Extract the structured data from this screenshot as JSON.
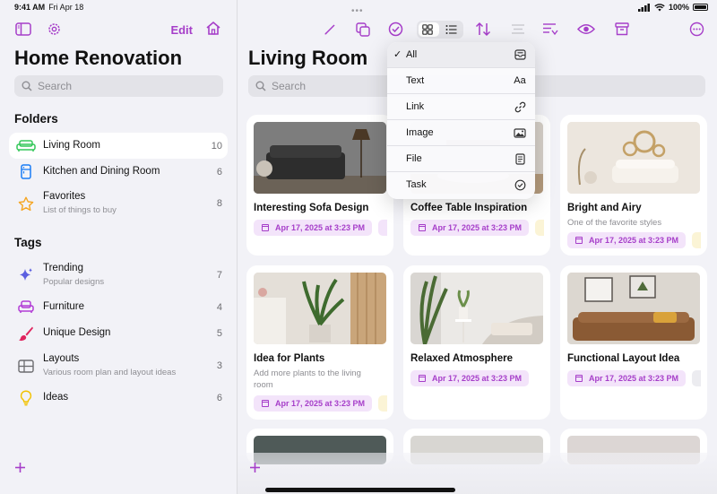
{
  "status": {
    "time": "9:41 AM",
    "date": "Fri Apr 18",
    "battery": "100%"
  },
  "sidebar": {
    "edit_label": "Edit",
    "title": "Home Renovation",
    "search_placeholder": "Search",
    "folders_heading": "Folders",
    "folders": [
      {
        "label": "Living Room",
        "count": "10",
        "icon": "sofa-icon",
        "active": true
      },
      {
        "label": "Kitchen and Dining Room",
        "count": "6",
        "icon": "fridge-icon"
      },
      {
        "label": "Favorites",
        "sub": "List of things to buy",
        "count": "8",
        "icon": "star-icon"
      }
    ],
    "tags_heading": "Tags",
    "tags": [
      {
        "label": "Trending",
        "sub": "Popular designs",
        "count": "7",
        "icon": "sparkles-icon"
      },
      {
        "label": "Furniture",
        "count": "4",
        "icon": "armchair-icon"
      },
      {
        "label": "Unique Design",
        "count": "5",
        "icon": "paintbrush-icon"
      },
      {
        "label": "Layouts",
        "sub": "Various room plan and layout ideas",
        "count": "3",
        "icon": "grid-layout-icon"
      },
      {
        "label": "Ideas",
        "count": "6",
        "icon": "lightbulb-icon"
      }
    ]
  },
  "main": {
    "title": "Living Room",
    "search_placeholder": "Search",
    "cards": [
      {
        "title": "Interesting Sofa Design",
        "date": "Apr 17, 2025 at 3:23 PM"
      },
      {
        "title": "Coffee Table Inspiration",
        "date": "Apr 17, 2025 at 3:23 PM"
      },
      {
        "title": "Bright and Airy",
        "sub": "One of the favorite styles",
        "date": "Apr 17, 2025 at 3:23 PM"
      },
      {
        "title": "Idea for Plants",
        "sub": "Add more plants to the living room",
        "date": "Apr 17, 2025 at 3:23 PM"
      },
      {
        "title": "Relaxed Atmosphere",
        "date": "Apr 17, 2025 at 3:23 PM"
      },
      {
        "title": "Functional Layout Idea",
        "date": "Apr 17, 2025 at 3:23 PM"
      }
    ]
  },
  "filter_menu": {
    "items": [
      {
        "label": "All",
        "checked": true,
        "icon": "tray-icon"
      },
      {
        "label": "Text",
        "icon_text": "Aa"
      },
      {
        "label": "Link",
        "icon": "link-icon"
      },
      {
        "label": "Image",
        "icon": "photo-icon"
      },
      {
        "label": "File",
        "icon": "doc-icon"
      },
      {
        "label": "Task",
        "icon": "checkmark-circle-icon"
      }
    ]
  },
  "colors": {
    "accent": "#a63ec9",
    "chip_bg": "#f3e4fa"
  }
}
